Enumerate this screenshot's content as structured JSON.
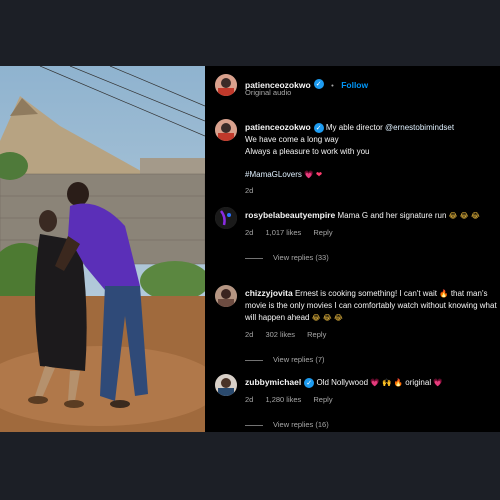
{
  "header": {
    "username": "patienceozokwo",
    "separator": "•",
    "follow_label": "Follow",
    "audio": "Original audio"
  },
  "caption": {
    "username": "patienceozokwo",
    "text_prefix": "My able director",
    "mention": "@ernestobimindset",
    "line2": "We have come a long way",
    "line3": "Always a pleasure to work with you",
    "hashtag": "#MamaGLovers",
    "hashtag_emoji": "💗 ❤",
    "time": "2d"
  },
  "comments": [
    {
      "username": "rosybelabeautyempire",
      "text": "Mama G and her signature run",
      "emoji": "😂 😂 😂",
      "time": "2d",
      "likes": "1,017 likes",
      "reply": "Reply",
      "view_replies": "View replies (33)"
    },
    {
      "username": "chizzyjovita",
      "text": "Ernest is cooking something! I can't wait",
      "emoji_inline": "🔥",
      "text_rest": "that man's movie is the only movies I can comfortably watch without knowing what will happen ahead",
      "emoji": "😂 😂 😂",
      "time": "2d",
      "likes": "302 likes",
      "reply": "Reply",
      "view_replies": "View replies (7)"
    },
    {
      "username": "zubbymichael",
      "text": "Old Nollywood",
      "emoji": "💗 🙌 🔥",
      "text_rest": "original",
      "emoji_end": "💗",
      "time": "2d",
      "likes": "1,280 likes",
      "reply": "Reply",
      "view_replies": "View replies (16)"
    }
  ],
  "colors": {
    "background": "#1c1f26",
    "link": "#e0f1ff",
    "follow": "#0095f6",
    "verified": "#1d9bf0"
  }
}
